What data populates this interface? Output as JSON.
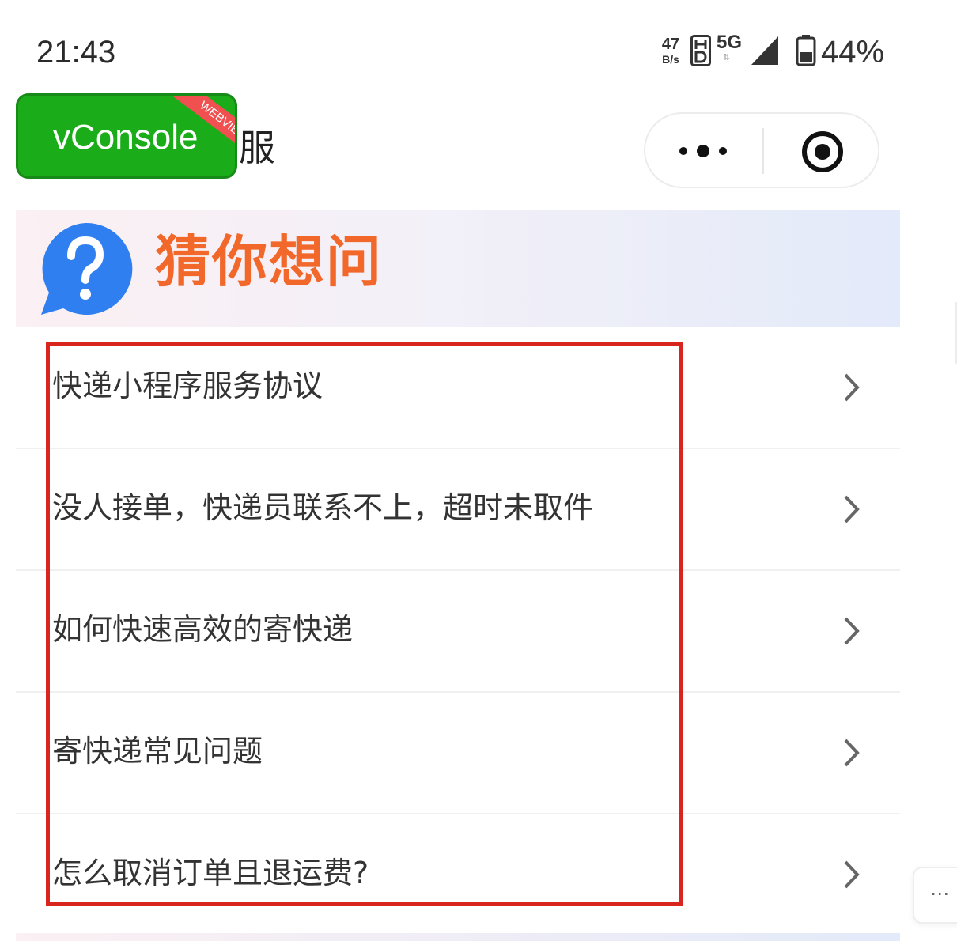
{
  "status_bar": {
    "time": "21:43",
    "net_speed_value": "47",
    "net_speed_unit": "B/s",
    "network_type": "5G",
    "battery_percent": "44%",
    "battery_level": 0.44
  },
  "header": {
    "vconsole_label": "vConsole",
    "vconsole_ribbon": "WEBVIEW",
    "title_fragment": "服"
  },
  "banner": {
    "title": "猜你想问",
    "icon": "question-bubble-icon",
    "title_color": "#f2682a",
    "icon_color": "#2f7ff0"
  },
  "faq": {
    "items": [
      {
        "label": "快递小程序服务协议"
      },
      {
        "label": "没人接单，快递员联系不上，超时未取件"
      },
      {
        "label": "如何快速高效的寄快递"
      },
      {
        "label": "寄快递常见问题"
      },
      {
        "label": "怎么取消订单且退运费?"
      }
    ]
  },
  "floating": {
    "more_label": "⋯"
  },
  "colors": {
    "vconsole_green": "#1aad19",
    "highlight_red": "#d8261f"
  }
}
